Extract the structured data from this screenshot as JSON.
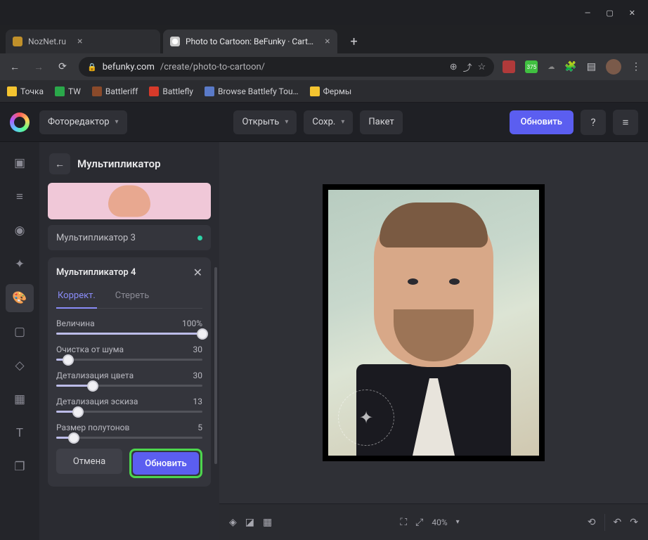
{
  "browser": {
    "tabs": [
      {
        "label": "NozNet.ru",
        "favicon": "#c0902a"
      },
      {
        "label": "Photo to Cartoon: BeFunky · Cart…",
        "favicon": "#ffffff",
        "active": true
      }
    ],
    "url_host": "befunky.com",
    "url_path": "/create/photo-to-cartoon/",
    "ext_badge": "375",
    "bookmarks": [
      {
        "label": "Точка",
        "color": "#f4c430"
      },
      {
        "label": "TW",
        "color": "#2aa84a"
      },
      {
        "label": "Battleriff",
        "color": "#8a4a2a"
      },
      {
        "label": "Battlefly",
        "color": "#d63a2a"
      },
      {
        "label": "Browse Battlefy Tou…",
        "color": "#5a7ac8"
      },
      {
        "label": "Фермы",
        "color": "#f4c430"
      }
    ]
  },
  "topbar": {
    "editor_label": "Фоторедактор",
    "open": "Открыть",
    "save": "Сохр.",
    "batch": "Пакет",
    "upgrade": "Обновить"
  },
  "rail_icons": [
    "image-icon",
    "sliders-icon",
    "eye-icon",
    "sparkles-icon",
    "palette-icon",
    "crop-icon",
    "shapes-icon",
    "grid-icon",
    "text-icon",
    "layers-icon"
  ],
  "panel": {
    "title": "Мультипликатор",
    "preset3": "Мультипликатор 3",
    "card_title": "Мультипликатор 4",
    "tab_adjust": "Коррект.",
    "tab_erase": "Стереть",
    "sliders": [
      {
        "label": "Величина",
        "value": "100%",
        "pct": 100
      },
      {
        "label": "Очистка от шума",
        "value": "30",
        "pct": 8
      },
      {
        "label": "Детализация цвета",
        "value": "30",
        "pct": 25
      },
      {
        "label": "Детализация эскиза",
        "value": "13",
        "pct": 15
      },
      {
        "label": "Размер полутонов",
        "value": "5",
        "pct": 12
      }
    ],
    "cancel": "Отмена",
    "update": "Обновить"
  },
  "canvasbar": {
    "zoom": "40%"
  }
}
